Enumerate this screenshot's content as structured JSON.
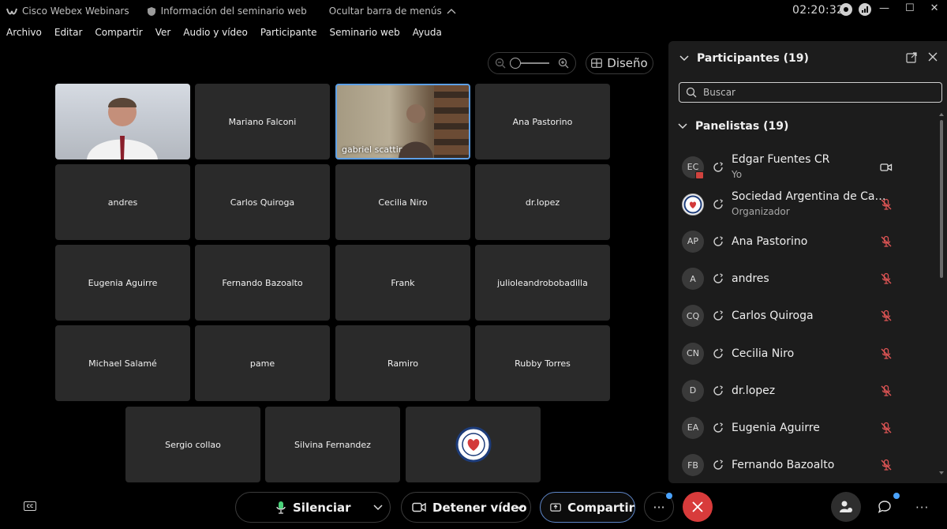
{
  "titlebar": {
    "app_name": "Cisco Webex Webinars",
    "info_label": "Información del seminario web",
    "hide_menu_label": "Ocultar barra de menús",
    "clock": "02:20:32"
  },
  "menu": [
    "Archivo",
    "Editar",
    "Compartir",
    "Ver",
    "Audio y vídeo",
    "Participante",
    "Seminario web",
    "Ayuda"
  ],
  "layout_button": "Diseño",
  "grid": {
    "tiles": [
      {
        "name": "Edgar Fuentes CR",
        "type": "video-edgar"
      },
      {
        "name": "Mariano Falconi",
        "type": "plain"
      },
      {
        "name": "gabriel scattini",
        "type": "video-gabriel"
      },
      {
        "name": "Ana Pastorino",
        "type": "plain"
      },
      {
        "name": "andres",
        "type": "plain"
      },
      {
        "name": "Carlos Quiroga",
        "type": "plain"
      },
      {
        "name": "Cecilia Niro",
        "type": "plain"
      },
      {
        "name": "dr.lopez",
        "type": "plain"
      },
      {
        "name": "Eugenia Aguirre",
        "type": "plain"
      },
      {
        "name": "Fernando Bazoalto",
        "type": "plain"
      },
      {
        "name": "Frank",
        "type": "plain"
      },
      {
        "name": "julioleandrobobadilla",
        "type": "plain"
      },
      {
        "name": "Michael Salamé",
        "type": "plain"
      },
      {
        "name": "pame",
        "type": "plain"
      },
      {
        "name": "Ramiro",
        "type": "plain"
      },
      {
        "name": "Rubby Torres",
        "type": "plain"
      },
      {
        "name": "Sergio collao",
        "type": "plain"
      },
      {
        "name": "Silvina Fernandez",
        "type": "plain"
      },
      {
        "name": "",
        "type": "logo"
      }
    ]
  },
  "panel": {
    "title": "Participantes (19)",
    "search_placeholder": "Buscar",
    "section_title": "Panelistas (19)",
    "participants": [
      {
        "initials": "EC",
        "name": "Edgar Fuentes CR",
        "role": "Yo",
        "icon": "video-icon",
        "avatar": "initials-badge"
      },
      {
        "initials": "",
        "name": "Sociedad Argentina de Card...",
        "role": "Organizador",
        "icon": "mic-muted-icon",
        "avatar": "logo"
      },
      {
        "initials": "AP",
        "name": "Ana Pastorino",
        "role": "",
        "icon": "mic-muted-icon",
        "avatar": "initials"
      },
      {
        "initials": "A",
        "name": "andres",
        "role": "",
        "icon": "mic-muted-icon",
        "avatar": "initials"
      },
      {
        "initials": "CQ",
        "name": "Carlos Quiroga",
        "role": "",
        "icon": "mic-muted-icon",
        "avatar": "initials"
      },
      {
        "initials": "CN",
        "name": "Cecilia Niro",
        "role": "",
        "icon": "mic-muted-icon",
        "avatar": "initials"
      },
      {
        "initials": "D",
        "name": "dr.lopez",
        "role": "",
        "icon": "mic-muted-icon",
        "avatar": "initials"
      },
      {
        "initials": "EA",
        "name": "Eugenia Aguirre",
        "role": "",
        "icon": "mic-muted-icon",
        "avatar": "initials"
      },
      {
        "initials": "FB",
        "name": "Fernando Bazoalto",
        "role": "",
        "icon": "mic-muted-icon",
        "avatar": "initials"
      }
    ]
  },
  "toolbar": {
    "mute_label": "Silenciar",
    "video_label": "Detener vídeo",
    "share_label": "Compartir"
  },
  "colors": {
    "accent_blue": "#5ea0e6",
    "end_red": "#d83b3b",
    "muted_red": "#e05555",
    "tile_bg": "#2a2a2a",
    "panel_bg": "#1c1c1c"
  }
}
